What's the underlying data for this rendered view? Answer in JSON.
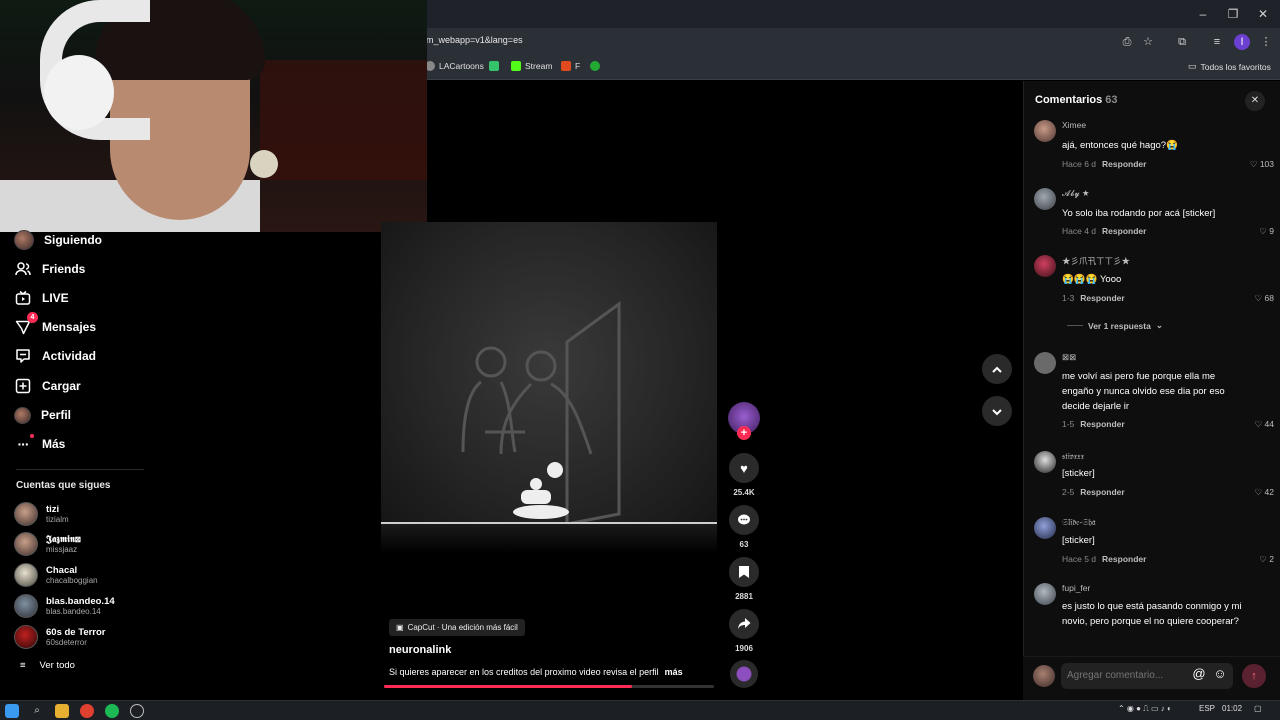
{
  "browser": {
    "url_fragment": "m_webapp=v1&lang=es",
    "bookmarks": [
      {
        "label": "LACartoons",
        "color": "#888888"
      },
      {
        "label": "",
        "color": "#35c46a"
      },
      {
        "label": "Stream",
        "color": "#53fc18"
      },
      {
        "label": "F",
        "color": "#e04a1f"
      },
      {
        "label": "",
        "color": "#22aa33"
      }
    ],
    "all_favorites": "Todos los favoritos",
    "profile_initial": "I"
  },
  "sidebar": {
    "items": [
      {
        "label": "Siguiendo",
        "icon": "avatar"
      },
      {
        "label": "Friends",
        "icon": "friends-icon"
      },
      {
        "label": "LIVE",
        "icon": "live-icon"
      },
      {
        "label": "Mensajes",
        "icon": "messages-icon",
        "badge": "4"
      },
      {
        "label": "Actividad",
        "icon": "activity-icon"
      },
      {
        "label": "Cargar",
        "icon": "upload-icon"
      },
      {
        "label": "Perfil",
        "icon": "avatar"
      },
      {
        "label": "Más",
        "icon": "more-icon"
      }
    ],
    "following_title": "Cuentas que sigues",
    "following": [
      {
        "name": "tizi",
        "user": "tizialm"
      },
      {
        "name": "𝕵𝖆𝖟𝖒𝖎𝖓⊠",
        "user": "missjaaz"
      },
      {
        "name": "Chacal",
        "user": "chacalboggian"
      },
      {
        "name": "blas.bandeo.14",
        "user": "blas.bandeo.14"
      },
      {
        "name": "60s de Terror",
        "user": "60sdeterror"
      }
    ],
    "see_all": "Ver todo"
  },
  "video": {
    "capcut": "CapCut · Una edición más fácil",
    "author": "neuronalink",
    "caption": "Si quieres aparecer en los creditos del proximo video revisa el perfil",
    "more": "más",
    "progress": 0.75
  },
  "actions": {
    "likes": "25.4K",
    "comments": "63",
    "saves": "2881",
    "shares": "1906"
  },
  "comments_panel": {
    "title": "Comentarios",
    "count": "63",
    "reply_label": "Responder",
    "view_replies": "Ver 1 respuesta",
    "input_placeholder": "Agregar comentario...",
    "items": [
      {
        "user": "Ximee",
        "text": "ajá, entonces qué hago?😭",
        "time": "Hace 6 d",
        "likes": "103"
      },
      {
        "user": "𝓐𝓫𝔂 ★",
        "text": "Yo solo iba rodando por acá [sticker]",
        "time": "Hace 4 d",
        "likes": "9"
      },
      {
        "user": "★彡爪卂ㄒㄒ彡★",
        "text": "😭😭😭 Yooo",
        "time": "1-3",
        "likes": "68"
      },
      {
        "user": "⊠⊠",
        "text": "me volví asi pero fue porque ella me engaño y nunca olvido ese dia por eso decide dejarle ir",
        "time": "1-5",
        "likes": "44"
      },
      {
        "user": "𝔰𝔱𝔦𝔳𝔵𝔵𝔵",
        "text": "[sticker]",
        "time": "2-5",
        "likes": "42"
      },
      {
        "user": "𝔖𝔩𝔦𝔡𝔢-𝔖𝔥𝔞",
        "text": "[sticker]",
        "time": "Hace 5 d",
        "likes": "2"
      },
      {
        "user": "fupi_fer",
        "text": "es justo lo que está pasando conmigo y mi novio, pero porque el no quiere cooperar?",
        "time": "",
        "likes": ""
      }
    ]
  },
  "taskbar": {
    "lang": "ESP",
    "time": "01:02"
  },
  "colors": {
    "accent": "#fe2c55",
    "panel": "#0e0e0e",
    "chrome": "#2b2f36"
  }
}
